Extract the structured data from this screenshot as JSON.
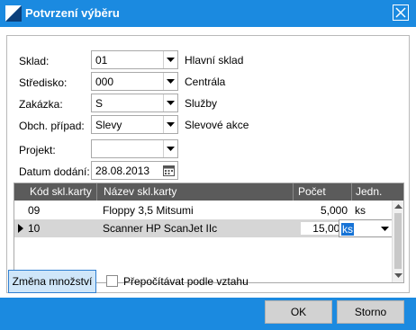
{
  "window": {
    "title": "Potvrzení výběru"
  },
  "form": {
    "sklad": {
      "label": "Sklad:",
      "value": "01",
      "desc": "Hlavní sklad"
    },
    "stredisko": {
      "label": "Středisko:",
      "value": "000",
      "desc": "Centrála"
    },
    "zakazka": {
      "label": "Zakázka:",
      "value": "S",
      "desc": "Služby"
    },
    "obch_pripad": {
      "label": "Obch. případ:",
      "value": "Slevy",
      "desc": "Slevové akce"
    },
    "projekt": {
      "label": "Projekt:",
      "value": ""
    },
    "datum": {
      "label": "Datum dodání:",
      "value": "28.08.2013"
    }
  },
  "grid": {
    "headers": [
      "Kód skl.karty",
      "Název skl.karty",
      "Počet",
      "Jedn."
    ],
    "rows": [
      {
        "kod": "09",
        "nazev": "Floppy 3,5 Mitsumi",
        "pocet": "5,000",
        "jedn": "ks"
      },
      {
        "kod": "10",
        "nazev": "Scanner HP ScanJet IIc",
        "pocet": "15,000",
        "jedn": "ks"
      }
    ]
  },
  "bottom": {
    "zmena_label": "Změna množství",
    "prepocitavat_label": "Přepočítávat podle vztahu"
  },
  "footer": {
    "ok_label": "OK",
    "storno_label": "Storno"
  },
  "colors": {
    "titlebar": "#1b8ae0",
    "selection": "#1673d6"
  }
}
